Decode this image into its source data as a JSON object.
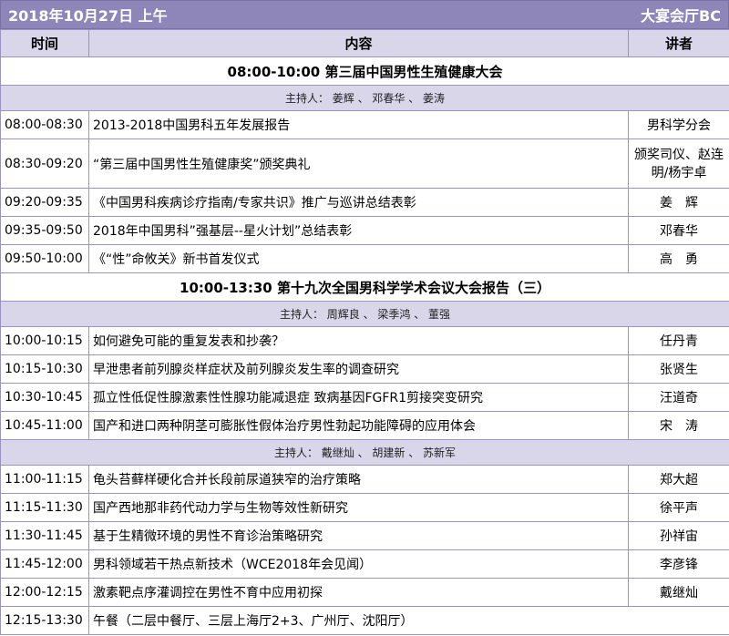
{
  "header": {
    "date": "2018年10月27日 上午",
    "venue": "大宴会厅BC"
  },
  "columns": {
    "time": "时间",
    "content": "内容",
    "speaker": "讲者"
  },
  "sessions": [
    {
      "title": "08:00-10:00 第三届中国男性生殖健康大会",
      "host": "主持人： 姜辉 、 邓春华 、 姜涛",
      "items": [
        {
          "time": "08:00-08:30",
          "content": "2013-2018中国男科五年发展报告",
          "speaker": "男科学分会"
        },
        {
          "time": "08:30-09:20",
          "content": "“第三届中国男性生殖健康奖”颁奖典礼",
          "speaker": "颁奖司仪、赵连明/杨宇卓"
        },
        {
          "time": "09:20-09:35",
          "content": "《中国男科疾病诊疗指南/专家共识》推广与巡讲总结表彰",
          "speaker": "姜　辉"
        },
        {
          "time": "09:35-09:50",
          "content": "2018年中国男科”强基层--星火计划”总结表彰",
          "speaker": "邓春华"
        },
        {
          "time": "09:50-10:00",
          "content": "《“性”命攸关》新书首发仪式",
          "speaker": "高　勇"
        }
      ]
    },
    {
      "title": "10:00-13:30 第十九次全国男科学学术会议大会报告（三）",
      "host": "主持人： 周辉良 、 梁季鸿 、 董强",
      "items": [
        {
          "time": "10:00-10:15",
          "content": "如何避免可能的重复发表和抄袭？",
          "speaker": "任丹青"
        },
        {
          "time": "10:15-10:30",
          "content": "早泄患者前列腺炎样症状及前列腺炎发生率的调查研究",
          "speaker": "张贤生"
        },
        {
          "time": "10:30-10:45",
          "content": "孤立性低促性腺激素性性腺功能减退症 致病基因FGFR1剪接突变研究",
          "speaker": "汪道奇"
        },
        {
          "time": "10:45-11:00",
          "content": "国产和进口两种阴茎可膨胀性假体治疗男性勃起功能障碍的应用体会",
          "speaker": "宋　涛"
        }
      ]
    },
    {
      "title": "",
      "host": "主持人： 戴继灿 、 胡建新 、 苏新军",
      "items": [
        {
          "time": "11:00-11:15",
          "content": "龟头苔藓样硬化合并长段前尿道狭窄的治疗策略",
          "speaker": "郑大超"
        },
        {
          "time": "11:15-11:30",
          "content": "国产西地那非药代动力学与生物等效性新研究",
          "speaker": "徐平声"
        },
        {
          "time": "11:30-11:45",
          "content": "基于生精微环境的男性不育诊治策略研究",
          "speaker": "孙祥宙"
        },
        {
          "time": "11:45-12:00",
          "content": "男科领域若干热点新技术（WCE2018年会见闻）",
          "speaker": "李彦锋"
        },
        {
          "time": "12:00-12:15",
          "content": "激素靶点序灌调控在男性不育中应用初探",
          "speaker": "戴继灿"
        }
      ]
    }
  ],
  "lunch": {
    "time": "12:15-13:30",
    "content": "午餐（二层中餐厅、三层上海厅2+3、广州厅、沈阳厅）"
  },
  "colors": {
    "header_bg": "#8e85b9",
    "sub_bg": "#d9d6ea",
    "border": "#9a93c2"
  }
}
